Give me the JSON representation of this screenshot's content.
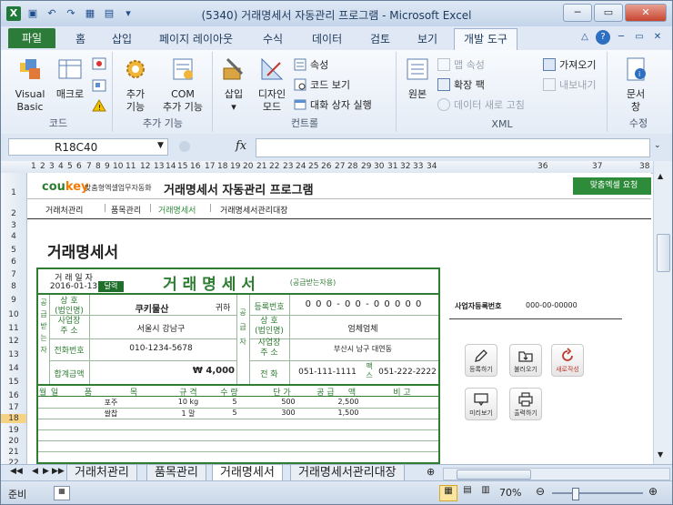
{
  "window": {
    "title": "(5340) 거래명세서 자동관리 프로그램  -  Microsoft Excel",
    "controls": {
      "minimize": "─",
      "restore": "▭",
      "close": "✕"
    }
  },
  "ribbon": {
    "file_tab": "파일",
    "tabs": [
      "홈",
      "삽입",
      "페이지 레이아웃",
      "수식",
      "데이터",
      "검토",
      "보기"
    ],
    "active_tab": "개발 도구",
    "groups": {
      "code": {
        "label": "코드",
        "vba": "Visual\nBasic",
        "macro": "매크로"
      },
      "addins": {
        "label": "추가 기능",
        "addin": "추가\n기능",
        "com": "COM\n추가 기능"
      },
      "controls": {
        "label": "컨트롤",
        "insert": "삽입",
        "design": "디자인\n모드",
        "properties": "속성",
        "view_code": "코드 보기",
        "dialog": "대화 상자 실행"
      },
      "xml": {
        "label": "XML",
        "source": "원본",
        "map_props": "맵 속성",
        "expansion": "확장 팩",
        "refresh": "데이터 새로 고침",
        "import": "가져오기",
        "export": "내보내기"
      },
      "modify": {
        "label": "수정",
        "doc_panel": "문서\n창"
      }
    }
  },
  "formula_bar": {
    "name_box": "R18C40",
    "fx": "fx",
    "value": ""
  },
  "columns": [
    "1",
    "2",
    "3",
    "4",
    "5",
    "6",
    "7",
    "8",
    "9",
    "10",
    "11",
    "12",
    "13",
    "14",
    "15",
    "16",
    "17",
    "18",
    "19",
    "20",
    "21",
    "22",
    "23",
    "24",
    "25",
    "26",
    "27",
    "28",
    "29",
    "30",
    "31",
    "32",
    "33",
    "34",
    "36",
    "37",
    "38"
  ],
  "rows": [
    "1",
    "2",
    "3",
    "4",
    "5",
    "6",
    "7",
    "8",
    "9",
    "10",
    "11",
    "12",
    "13",
    "14",
    "15",
    "16",
    "17",
    "18",
    "19",
    "20",
    "21",
    "22"
  ],
  "selected_row": "18",
  "sheet": {
    "logo_main": "cou",
    "logo_accent": "key",
    "logo_sub": "맞춤형엑셀업무자동화",
    "app_title": "거래명세서 자동관리 프로그램",
    "request_button": "맞춤엑셀 요청",
    "nav": [
      "거래처관리",
      "품목관리",
      "거래명세서",
      "거래명세서관리대장"
    ],
    "heading": "거래명세서",
    "form": {
      "date_label": "거 래 일 자",
      "date_value": "2016-01-13",
      "calendar_btn": "달력",
      "form_title": "거 래 명 세 서",
      "form_subtitle": "(공급받는자용)",
      "supplied_label": "공\n급\n받\n는\n자",
      "supplier_label": "공\n급\n자",
      "trade_name_label": "상 호\n(법인명)",
      "customer_name": "쿠키물산",
      "honorific": "귀하",
      "reg_label": "등록번호",
      "reg_value": "0 0 0 - 0 0 - 0 0 0 0 0",
      "address_label": "사업장\n주 소",
      "customer_address": "서울시 강남구",
      "supplier_trade_label": "상 호\n(법인명)",
      "supplier_name": "엄체엄체",
      "phone_label": "전화번호",
      "customer_phone": "010-1234-5678",
      "supplier_address_label": "사업장\n주 소",
      "supplier_address": "부산시 남구 대연동",
      "total_label": "합계금액",
      "total_value": "₩ 4,000",
      "tel_label": "전 화",
      "tel_value": "051-111-1111",
      "fax_label": "팩\n스",
      "fax_value": "051-222-2222",
      "columns": [
        "월",
        "일",
        "품",
        "목",
        "규 격",
        "수 량",
        "단 가",
        "공 급",
        "액",
        "비 고"
      ],
      "items": [
        {
          "name": "포주",
          "spec": "10 kg",
          "qty": "5",
          "price": "500",
          "amount": "2,500"
        },
        {
          "name": "쌀찹",
          "spec": "1 말",
          "qty": "5",
          "price": "300",
          "amount": "1,500"
        }
      ]
    },
    "side_reg_label": "사업자등록번호",
    "side_reg_value": "000-00-00000",
    "actions": [
      "등록하기",
      "불러오기",
      "새로작성",
      "미리보기",
      "출력하기"
    ]
  },
  "sheet_tabs": [
    "거래처관리",
    "품목관리",
    "거래명세서",
    "거래명세서관리대장"
  ],
  "active_sheet": "거래명세서",
  "status": {
    "ready": "준비",
    "zoom": "70%"
  }
}
